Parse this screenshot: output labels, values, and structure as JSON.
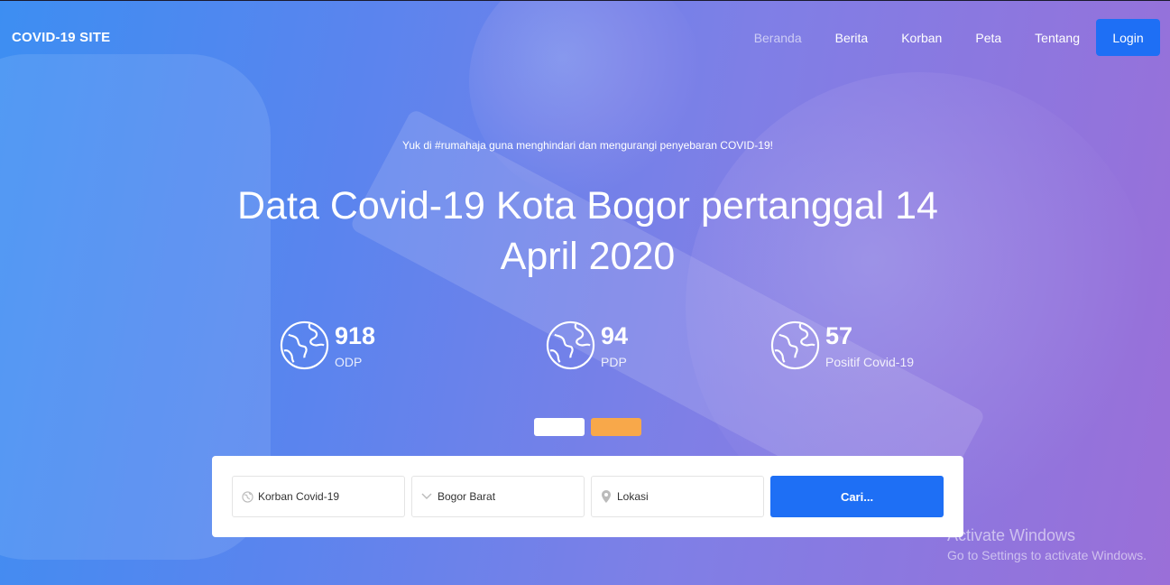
{
  "navbar": {
    "brand": "COVID-19 SITE",
    "links": [
      "Beranda",
      "Berita",
      "Korban",
      "Peta",
      "Tentang"
    ],
    "login_label": "Login"
  },
  "hero": {
    "subtitle": "Yuk di #rumahaja guna menghindari dan mengurangi penyebaran COVID-19!",
    "title": "Data Covid-19 Kota Bogor pertanggal 14 April 2020"
  },
  "stats": [
    {
      "value": "918",
      "label": "ODP"
    },
    {
      "value": "94",
      "label": "PDP"
    },
    {
      "value": "57",
      "label": "Positif Covid-19"
    }
  ],
  "search": {
    "category_value": "Korban Covid-19",
    "area_value": "Bogor Barat",
    "location_placeholder": "Lokasi",
    "button_label": "Cari..."
  },
  "watermark": {
    "line1": "Activate Windows",
    "line2": "Go to Settings to activate Windows."
  },
  "colors": {
    "accent": "#1e6ff5",
    "slider_dot_active": "#ffffff",
    "slider_dot_inactive": "#f8a84a"
  }
}
